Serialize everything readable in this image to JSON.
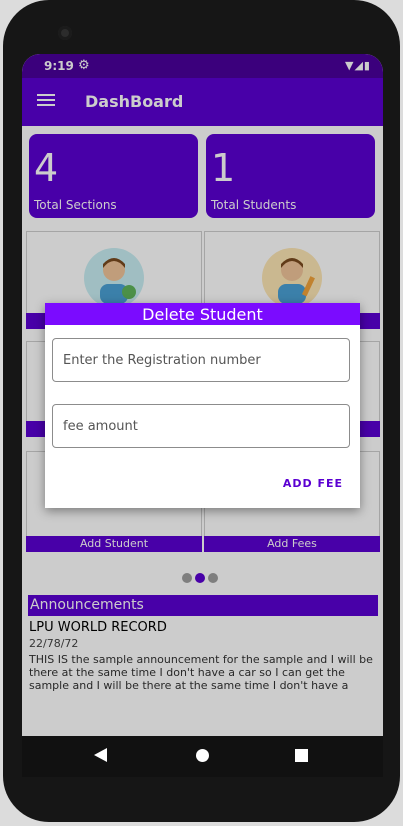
{
  "status": {
    "time": "9:19",
    "icons": "▼◢▮"
  },
  "appbar": {
    "title": "DashBoard"
  },
  "stats": [
    {
      "value": "4",
      "label": "Total Sections"
    },
    {
      "value": "1",
      "label": "Total Students"
    }
  ],
  "tiles": {
    "add_student": "Add Student",
    "add_fees": "Add Fees"
  },
  "dialog": {
    "title": "Delete Student",
    "registration_placeholder": "Enter the Registration number",
    "fee_placeholder": "fee amount",
    "action": "ADD FEE"
  },
  "announcements": {
    "header": "Announcements",
    "title": "LPU WORLD RECORD",
    "date": "22/78/72",
    "body": "THIS IS the sample announcement for the sample and I will be there at the same time I don't have a car so I can get the sample and I will be there at the same time I don't have a"
  },
  "colors": {
    "primary": "#5b00d2",
    "dialog_header": "#7b0bff",
    "status_bar": "#4a009c"
  }
}
